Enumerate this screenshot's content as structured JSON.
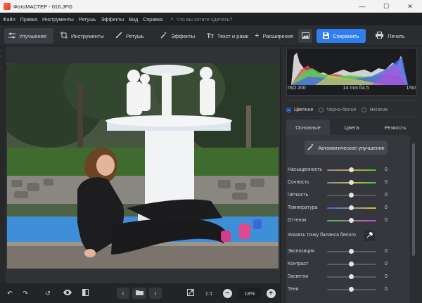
{
  "window": {
    "title": "ФотоМАСТЕР - 016.JPG",
    "controls": {
      "minimize": "—",
      "maximize": "☐",
      "close": "✕"
    }
  },
  "menu": {
    "items": [
      "Файл",
      "Правка",
      "Инструменты",
      "Ретушь",
      "Эффекты",
      "Вид",
      "Справка"
    ],
    "search_placeholder": "Что вы хотите сделать?"
  },
  "toolbar": {
    "tabs": [
      {
        "label": "Улучшения",
        "icon": "sliders-icon",
        "active": true
      },
      {
        "label": "Инструменты",
        "icon": "crop-icon",
        "active": false
      },
      {
        "label": "Ретушь",
        "icon": "brush-icon",
        "active": false
      },
      {
        "label": "Эффекты",
        "icon": "magic-wand-icon",
        "active": false
      },
      {
        "label": "Текст и рамк",
        "icon": "text-icon",
        "active": false
      },
      {
        "label": "Расширения",
        "icon": "plus-icon",
        "active": false
      }
    ],
    "save_label": "Сохранить",
    "print_label": "Печать",
    "accent": "#2f7ef0"
  },
  "bottombar": {
    "fit_label": "1:1",
    "zoom": "18%"
  },
  "panel": {
    "meta": {
      "iso": "ISO 200",
      "lens": "14 mm f/4.5",
      "shutter": "1/60"
    },
    "color_modes": [
      {
        "label": "Цветное",
        "selected": true
      },
      {
        "label": "Черно-белое",
        "selected": false
      },
      {
        "label": "Негатив",
        "selected": false
      }
    ],
    "subtabs": [
      {
        "label": "Основные",
        "active": true
      },
      {
        "label": "Цвета",
        "active": false
      },
      {
        "label": "Резкость",
        "active": false
      }
    ],
    "auto_button": "Автоматическое улучшение",
    "sliders_top": [
      {
        "label": "Насыщенность",
        "value": "0"
      },
      {
        "label": "Сочность",
        "value": "0"
      },
      {
        "label": "Чёткость",
        "value": "0"
      },
      {
        "label": "Температура",
        "value": "0"
      },
      {
        "label": "Оттенок",
        "value": "0"
      }
    ],
    "white_balance_label": "Указать точку баланса белого",
    "sliders_bottom": [
      {
        "label": "Экспозиция",
        "value": "0"
      },
      {
        "label": "Контраст",
        "value": "0"
      },
      {
        "label": "Засветки",
        "value": "0"
      },
      {
        "label": "Тени",
        "value": "0"
      }
    ]
  }
}
